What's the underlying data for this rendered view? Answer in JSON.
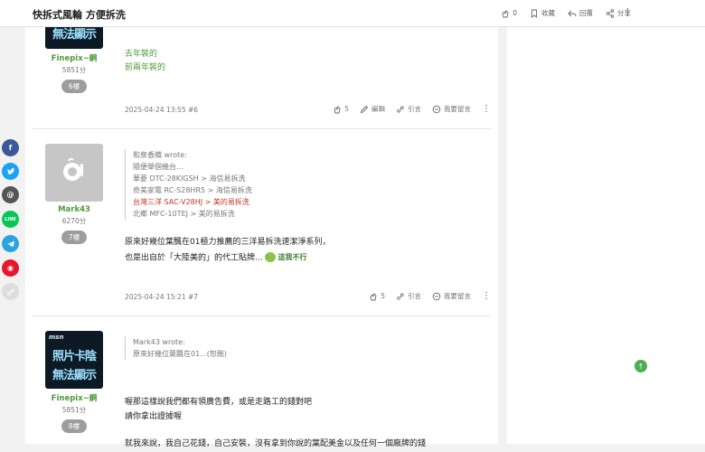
{
  "header": {
    "title": "快拆式風輪 方便拆洗",
    "like_count": "0",
    "favorite_label": "收藏",
    "reply_label": "回覆",
    "share_label": "分享"
  },
  "social": [
    "facebook-icon",
    "twitter-icon",
    "threads-icon",
    "line-icon",
    "telegram-icon",
    "weibo-icon",
    "link-icon"
  ],
  "social_line_label": "LINE",
  "posts": [
    {
      "author": "Finepix~鋼",
      "score": "5851分",
      "floor": "6樓",
      "lines": [
        "去年裝的",
        "前兩年裝的"
      ],
      "date": "2025-04-24 13:55 #6",
      "likes": "5",
      "edit_label": "編輯",
      "quote_label": "引言",
      "comment_label": "我要留言"
    },
    {
      "author": "Mark43",
      "score": "6270分",
      "floor": "7樓",
      "quote": {
        "head": "和泉香織 wrote:",
        "lines": [
          "隨便舉個幾台...",
          "華菱 DTC-28KIGSH > 海信易拆洗",
          "奇美家電 RC-S28HR5 > 海信易拆洗",
          "台灣三洋 SAC-V28HJ > 美的易拆洗",
          "北鄉 MFC-10TEJ > 美的易拆洗"
        ]
      },
      "body": [
        "原來好幾位葉飄在01極力推薦的三洋易拆洗速潔淨系列，",
        "也是出自於「大陸美的」的代工貼牌..."
      ],
      "sticker_text": "這我不行",
      "date": "2025-04-24 15:21 #7",
      "likes": "5",
      "quote_label": "引言",
      "comment_label": "我要留言"
    },
    {
      "author": "Finepix~鋼",
      "score": "5851分",
      "floor": "8樓",
      "quote": {
        "head": "Mark43 wrote:",
        "lines": [
          "原來好幾位葉飄在01...(恕刪)"
        ]
      },
      "body": [
        "喔那這樣說我們都有領廣告費，或是走路工的錢對吧",
        "請你拿出證據喔",
        "",
        "就我來說，我自己花錢，自己安裝，沒有拿到你說的葉配美金以及任何一個廠牌的錢"
      ]
    }
  ],
  "avatar_text": {
    "logo": "msn",
    "line1": "照片卡陰",
    "line2": "無法顯示"
  },
  "colors": {
    "accent_green": "#4f9a3c",
    "quote_red": "#c0392b",
    "facebook": "#3b5998",
    "twitter": "#1da1f2",
    "line": "#06c755",
    "telegram": "#2aa3e0",
    "weibo": "#e6162d"
  }
}
